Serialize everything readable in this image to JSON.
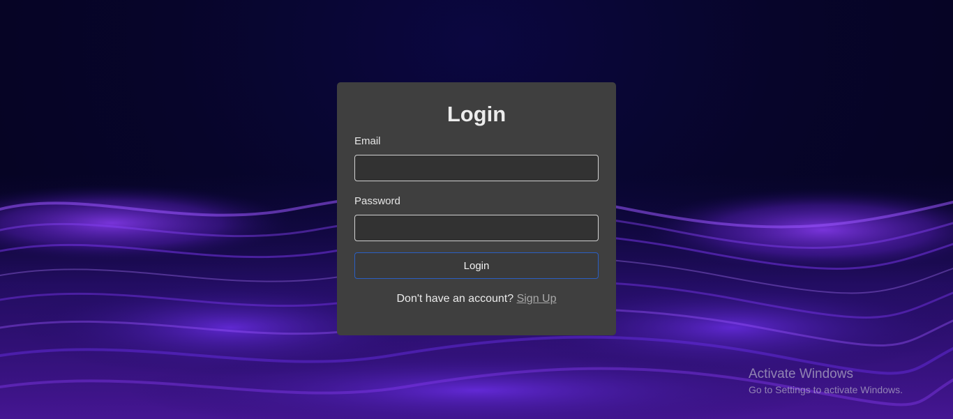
{
  "colors": {
    "card_background": "#3f3f3f",
    "input_background": "#323232",
    "button_border": "#2a5fc4",
    "background_dark": "#05031f",
    "wave_purple": "#7b2ff0"
  },
  "login_form": {
    "title": "Login",
    "email_label": "Email",
    "email_value": "",
    "password_label": "Password",
    "password_value": "",
    "login_button_label": "Login",
    "signup_prompt": "Don't have an account?",
    "signup_link_label": "Sign Up"
  },
  "windows_watermark": {
    "title": "Activate Windows",
    "subtitle": "Go to Settings to activate Windows."
  }
}
